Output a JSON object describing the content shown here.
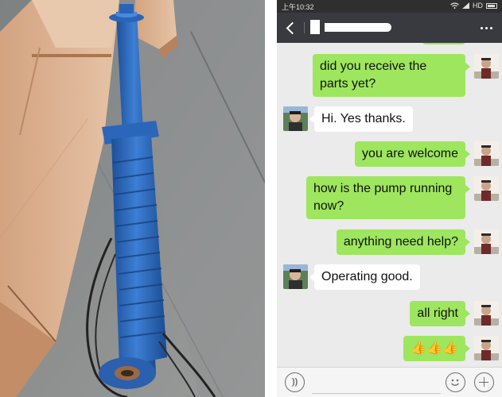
{
  "status_bar": {
    "time": "上午10:32",
    "network": "HD",
    "icons": [
      "wifi-icon",
      "signal-icon",
      "battery-icon"
    ]
  },
  "title_bar": {
    "icons": [
      "back-arrow-icon",
      "more-options-icon"
    ],
    "contact_name_redacted": true
  },
  "messages": [
    {
      "direction": "outgoing",
      "text": "did you receive the parts yet?"
    },
    {
      "direction": "incoming",
      "text": "Hi. Yes thanks."
    },
    {
      "direction": "outgoing",
      "text": "you are welcome"
    },
    {
      "direction": "outgoing",
      "text": "how is the pump running now?"
    },
    {
      "direction": "outgoing",
      "text": "anything need help?"
    },
    {
      "direction": "incoming",
      "text": "Operating good."
    },
    {
      "direction": "outgoing",
      "text": "all right"
    },
    {
      "direction": "outgoing",
      "text": "👍👍👍"
    }
  ],
  "input_bar": {
    "value": "",
    "icons": [
      "voice-icon",
      "emoji-icon",
      "plus-icon"
    ]
  },
  "photo": {
    "subject": "blue-submersible-pump-icon"
  },
  "colors": {
    "outgoing_bubble": "#9ee65e",
    "incoming_bubble": "#ffffff",
    "chat_background": "#ebebeb",
    "title_bar": "#393a3f",
    "pump_blue": "#2d6bc0"
  }
}
